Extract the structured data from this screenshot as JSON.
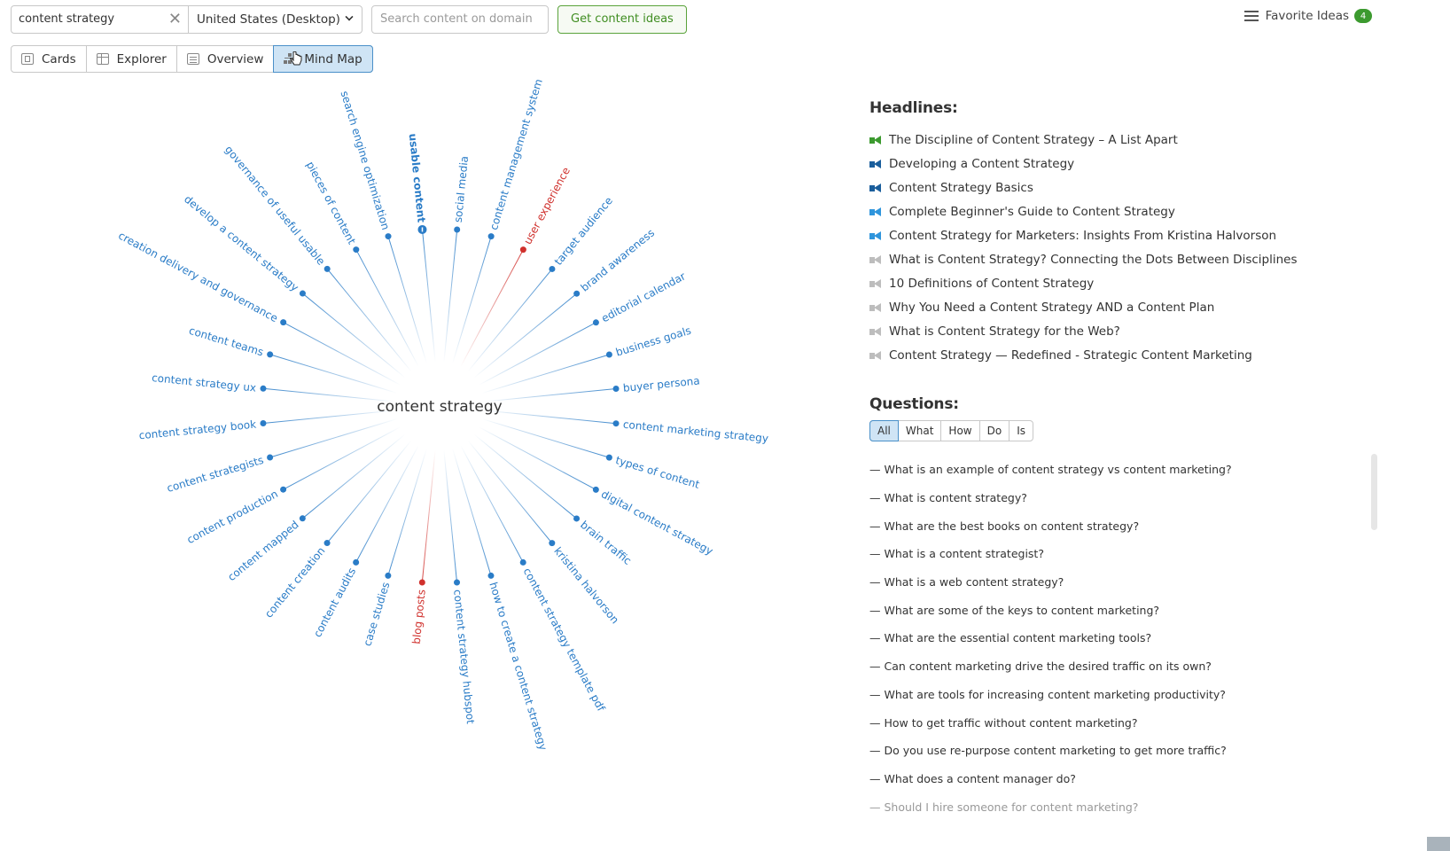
{
  "search": {
    "keyword": "content strategy",
    "database": "United States (Desktop)",
    "domain_placeholder": "Search content on domain",
    "submit_label": "Get content ideas"
  },
  "favorites": {
    "label": "Favorite Ideas",
    "count": "4"
  },
  "view_tabs": [
    {
      "label": "Cards",
      "icon": "cards-icon",
      "active": false
    },
    {
      "label": "Explorer",
      "icon": "table-icon",
      "active": false
    },
    {
      "label": "Overview",
      "icon": "overview-icon",
      "active": false
    },
    {
      "label": "Mind Map",
      "icon": "mind-map-icon",
      "active": true
    }
  ],
  "mind_map": {
    "center": "content strategy",
    "colors": {
      "normal": "#2a7cc7",
      "highlight": "#d0312d",
      "center": "#333333"
    },
    "nodes": [
      {
        "label": "usable content",
        "state": "expanded"
      },
      {
        "label": "social media",
        "state": "normal"
      },
      {
        "label": "content management system",
        "state": "normal"
      },
      {
        "label": "user experience",
        "state": "highlight"
      },
      {
        "label": "target audience",
        "state": "normal"
      },
      {
        "label": "brand awareness",
        "state": "normal"
      },
      {
        "label": "editorial calendar",
        "state": "normal"
      },
      {
        "label": "business goals",
        "state": "normal"
      },
      {
        "label": "buyer persona",
        "state": "normal"
      },
      {
        "label": "content marketing strategy",
        "state": "normal"
      },
      {
        "label": "types of content",
        "state": "normal"
      },
      {
        "label": "digital content strategy",
        "state": "normal"
      },
      {
        "label": "brain traffic",
        "state": "normal"
      },
      {
        "label": "kristina halvorson",
        "state": "normal"
      },
      {
        "label": "content strategy template pdf",
        "state": "normal"
      },
      {
        "label": "how to create a content strategy",
        "state": "normal"
      },
      {
        "label": "content strategy hubspot",
        "state": "normal"
      },
      {
        "label": "blog posts",
        "state": "highlight"
      },
      {
        "label": "case studies",
        "state": "normal"
      },
      {
        "label": "content audits",
        "state": "normal"
      },
      {
        "label": "content creation",
        "state": "normal"
      },
      {
        "label": "content mapped",
        "state": "normal"
      },
      {
        "label": "content production",
        "state": "normal"
      },
      {
        "label": "content strategists",
        "state": "normal"
      },
      {
        "label": "content strategy book",
        "state": "normal"
      },
      {
        "label": "content strategy ux",
        "state": "normal"
      },
      {
        "label": "content teams",
        "state": "normal"
      },
      {
        "label": "creation delivery and governance",
        "state": "normal"
      },
      {
        "label": "develop a content strategy",
        "state": "normal"
      },
      {
        "label": "governance of useful usable",
        "state": "normal"
      },
      {
        "label": "pieces of content",
        "state": "normal"
      },
      {
        "label": "search engine optimization",
        "state": "normal"
      }
    ]
  },
  "headlines": {
    "title": "Headlines:",
    "items": [
      {
        "text": "The Discipline of Content Strategy – A List Apart",
        "icon_color": "#3c9a2f",
        "level": "high"
      },
      {
        "text": "Developing a Content Strategy",
        "icon_color": "#1a5e9c",
        "level": "strong"
      },
      {
        "text": "Content Strategy Basics",
        "icon_color": "#1a5e9c",
        "level": "strong"
      },
      {
        "text": "Complete Beginner's Guide to Content Strategy",
        "icon_color": "#2f95dc",
        "level": "medium"
      },
      {
        "text": "Content Strategy for Marketers: Insights From Kristina Halvorson",
        "icon_color": "#2f95dc",
        "level": "medium"
      },
      {
        "text": "What is Content Strategy? Connecting the Dots Between Disciplines",
        "icon_color": "#bdbdbd",
        "level": "low"
      },
      {
        "text": "10 Definitions of Content Strategy",
        "icon_color": "#bdbdbd",
        "level": "low"
      },
      {
        "text": "Why You Need a Content Strategy AND a Content Plan",
        "icon_color": "#bdbdbd",
        "level": "low"
      },
      {
        "text": "What is Content Strategy for the Web?",
        "icon_color": "#bdbdbd",
        "level": "low"
      },
      {
        "text": "Content Strategy — Redefined - Strategic Content Marketing",
        "icon_color": "#bdbdbd",
        "level": "low"
      }
    ]
  },
  "questions": {
    "title": "Questions:",
    "filters": [
      {
        "label": "All",
        "active": true
      },
      {
        "label": "What",
        "active": false
      },
      {
        "label": "How",
        "active": false
      },
      {
        "label": "Do",
        "active": false
      },
      {
        "label": "Is",
        "active": false
      }
    ],
    "items": [
      "— What is an example of content strategy vs content marketing?",
      "— What is content strategy?",
      "— What are the best books on content strategy?",
      "— What is a content strategist?",
      "— What is a web content strategy?",
      "— What are some of the keys to content marketing?",
      "— What are the essential content marketing tools?",
      "— Can content marketing drive the desired traffic on its own?",
      "— What are tools for increasing content marketing productivity?",
      "— How to get traffic without content marketing?",
      "— Do you use re-purpose content marketing to get more traffic?",
      "— What does a content manager do?",
      "— Should I hire someone for content marketing?"
    ]
  }
}
